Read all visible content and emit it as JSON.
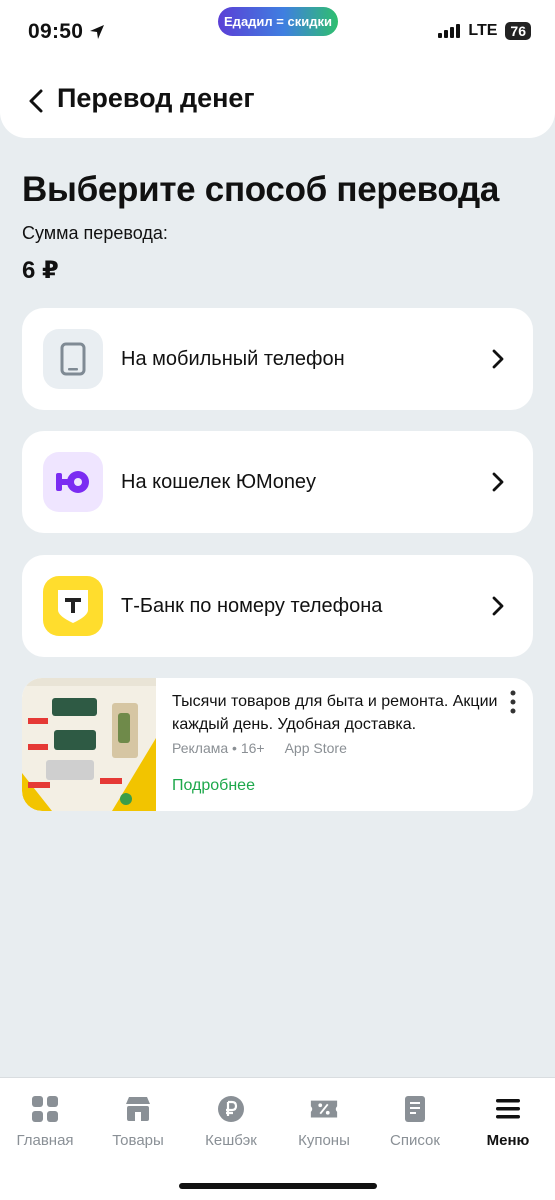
{
  "status_bar": {
    "time": "09:50",
    "promo_pill": "Едадил = скидки",
    "network": "LTE",
    "battery": "76"
  },
  "header": {
    "title": "Перевод денег"
  },
  "main": {
    "heading": "Выберите способ перевода",
    "sum_label": "Сумма перевода:",
    "sum_value": "6 ₽"
  },
  "methods": [
    {
      "label": "На мобильный телефон",
      "icon": "phone-icon",
      "icon_bg": "#e9eef2"
    },
    {
      "label": "На кошелек ЮMoney",
      "icon": "yumoney-icon",
      "icon_bg": "#efe5ff",
      "icon_color": "#7b2cf2"
    },
    {
      "label": "Т-Банк по номеру телефона",
      "icon": "tbank-icon",
      "icon_bg": "#ffdd2d"
    }
  ],
  "ad": {
    "text": "Тысячи товаров для быта и ремонта. Акции каждый день. Удобная доставка.",
    "meta_label": "Реклама • 16+",
    "meta_source": "App Store",
    "more_link": "Подробнее",
    "link_color": "#1da84b"
  },
  "tabbar": {
    "items": [
      {
        "label": "Главная",
        "icon": "grid-icon"
      },
      {
        "label": "Товары",
        "icon": "shop-icon"
      },
      {
        "label": "Кешбэк",
        "icon": "ruble-icon"
      },
      {
        "label": "Купоны",
        "icon": "coupon-icon"
      },
      {
        "label": "Список",
        "icon": "list-icon"
      },
      {
        "label": "Меню",
        "icon": "menu-icon",
        "active": true
      }
    ]
  }
}
